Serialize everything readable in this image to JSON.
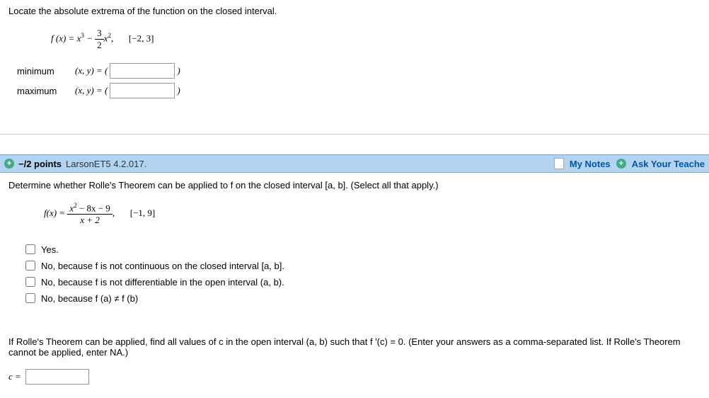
{
  "q1": {
    "instruction": "Locate the absolute extrema of the function on the closed interval.",
    "func_lhs": "f (x) = x",
    "exp3": "3",
    "minus": " − ",
    "frac_num": "3",
    "frac_den": "2",
    "xvar": "x",
    "exp2": "2",
    "comma": ",",
    "interval": "[−2, 3]",
    "min_label": "minimum",
    "max_label": "maximum",
    "xy_prefix": "(x, y) = (",
    "close_paren": ")"
  },
  "q2": {
    "points": "−/2 points",
    "ref": "LarsonET5 4.2.017.",
    "my_notes": "My Notes",
    "ask": "Ask Your Teache",
    "instruction": "Determine whether Rolle's Theorem can be applied to f on the closed interval [a, b]. (Select all that apply.)",
    "func_lhs": "f(x) = ",
    "frac_num": "x",
    "frac_num_exp": "2",
    "frac_num_rest": " − 8x − 9",
    "frac_den": "x + 2",
    "comma": ",",
    "interval": "[−1, 9]",
    "opts": [
      "Yes.",
      "No, because f is not continuous on the closed interval [a, b].",
      "No, because f is not differentiable in the open interval (a, b).",
      "No, because f (a) ≠ f (b)"
    ],
    "followup": "If Rolle's Theorem can be applied, find all values of c in the open interval (a, b) such that f '(c) = 0. (Enter your answers as a comma-separated list. If Rolle's Theorem cannot be applied, enter NA.)",
    "c_label": "c ="
  }
}
